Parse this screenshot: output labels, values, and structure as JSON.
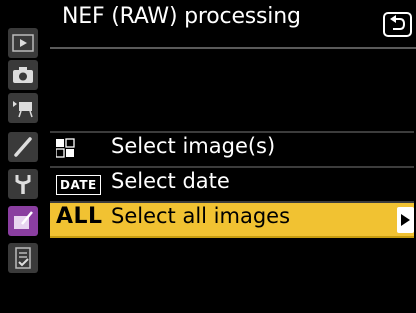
{
  "header": {
    "title": "NEF (RAW) processing",
    "back_icon": "return-arrow-icon"
  },
  "sidebar": {
    "items": [
      {
        "icon": "playback-icon"
      },
      {
        "icon": "camera-icon"
      },
      {
        "icon": "movie-icon"
      },
      {
        "icon": "pencil-icon"
      },
      {
        "icon": "wrench-icon"
      },
      {
        "icon": "retouch-icon",
        "active": true
      },
      {
        "icon": "my-menu-icon"
      }
    ],
    "active_color": "#8a3ea0"
  },
  "menu": {
    "items": [
      {
        "tag": "grid-icon",
        "label": "Select image(s)"
      },
      {
        "tag": "DATE",
        "label": "Select date"
      },
      {
        "tag": "ALL",
        "label": "Select all images",
        "selected": true,
        "arrow_icon": "right-arrow-icon"
      }
    ],
    "highlight_color": "#f1c232"
  }
}
